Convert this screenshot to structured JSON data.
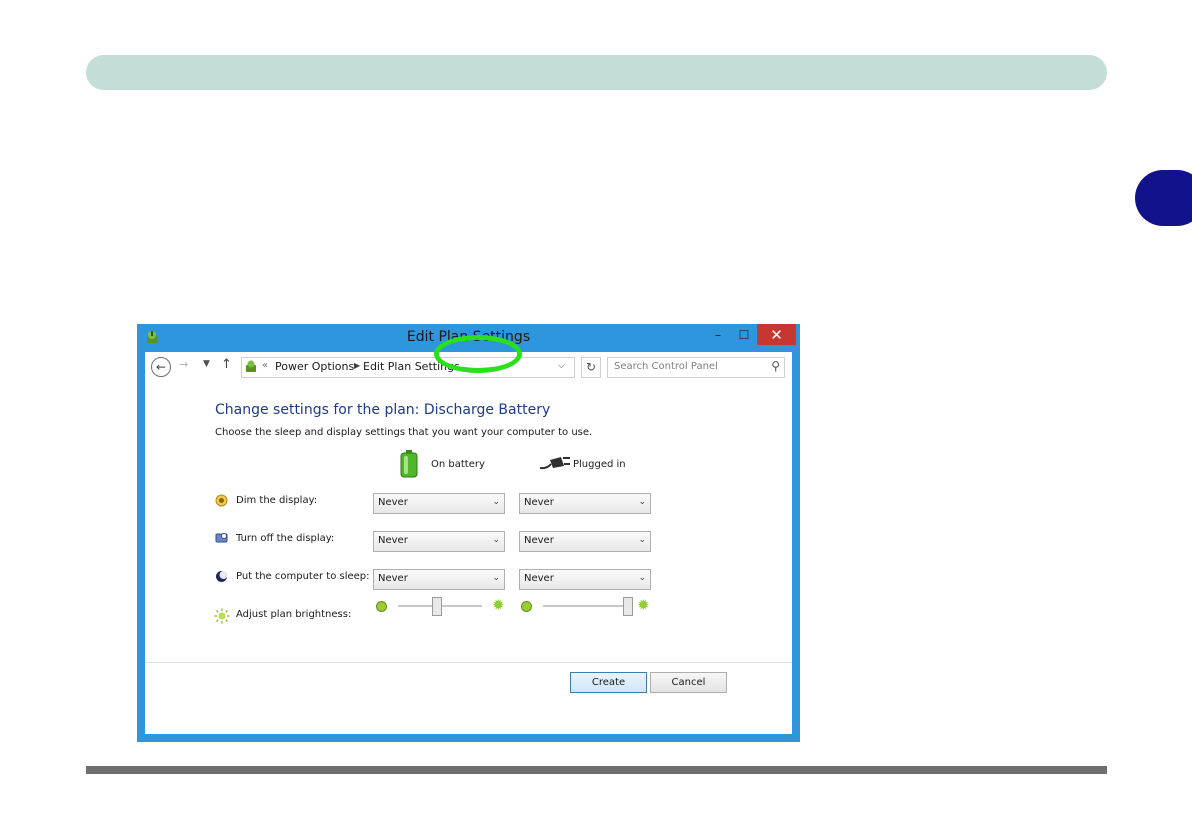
{
  "window": {
    "title": "Edit Plan Settings",
    "controls": {
      "minimize": "–",
      "maximize": "☐",
      "close": "✕"
    }
  },
  "addressbar": {
    "prefix": "«",
    "breadcrumb": [
      "Power Options",
      "Edit Plan Settings"
    ],
    "search_placeholder": "Search Control Panel"
  },
  "content": {
    "heading": "Change settings for the plan: Discharge Battery",
    "subheading": "Choose the sleep and display settings that you want your computer to use.",
    "columns": {
      "battery": "On battery",
      "plugged": "Plugged in"
    },
    "rows": [
      {
        "label": "Dim the display:",
        "on_battery": "Never",
        "plugged_in": "Never",
        "icon": "dim-display-icon"
      },
      {
        "label": "Turn off the display:",
        "on_battery": "Never",
        "plugged_in": "Never",
        "icon": "display-off-icon"
      },
      {
        "label": "Put the computer to sleep:",
        "on_battery": "Never",
        "plugged_in": "Never",
        "icon": "sleep-icon"
      }
    ],
    "brightness": {
      "label": "Adjust plan brightness:",
      "on_battery_level": 0.45,
      "plugged_in_level": 1.0
    },
    "buttons": {
      "create": "Create",
      "cancel": "Cancel"
    }
  },
  "colors": {
    "header_bar": "#c5ddd8",
    "chapter_tab": "#12138a",
    "window_frame": "#2d96dc",
    "close_button": "#c7372f",
    "highlight_ring": "#29e01a"
  }
}
